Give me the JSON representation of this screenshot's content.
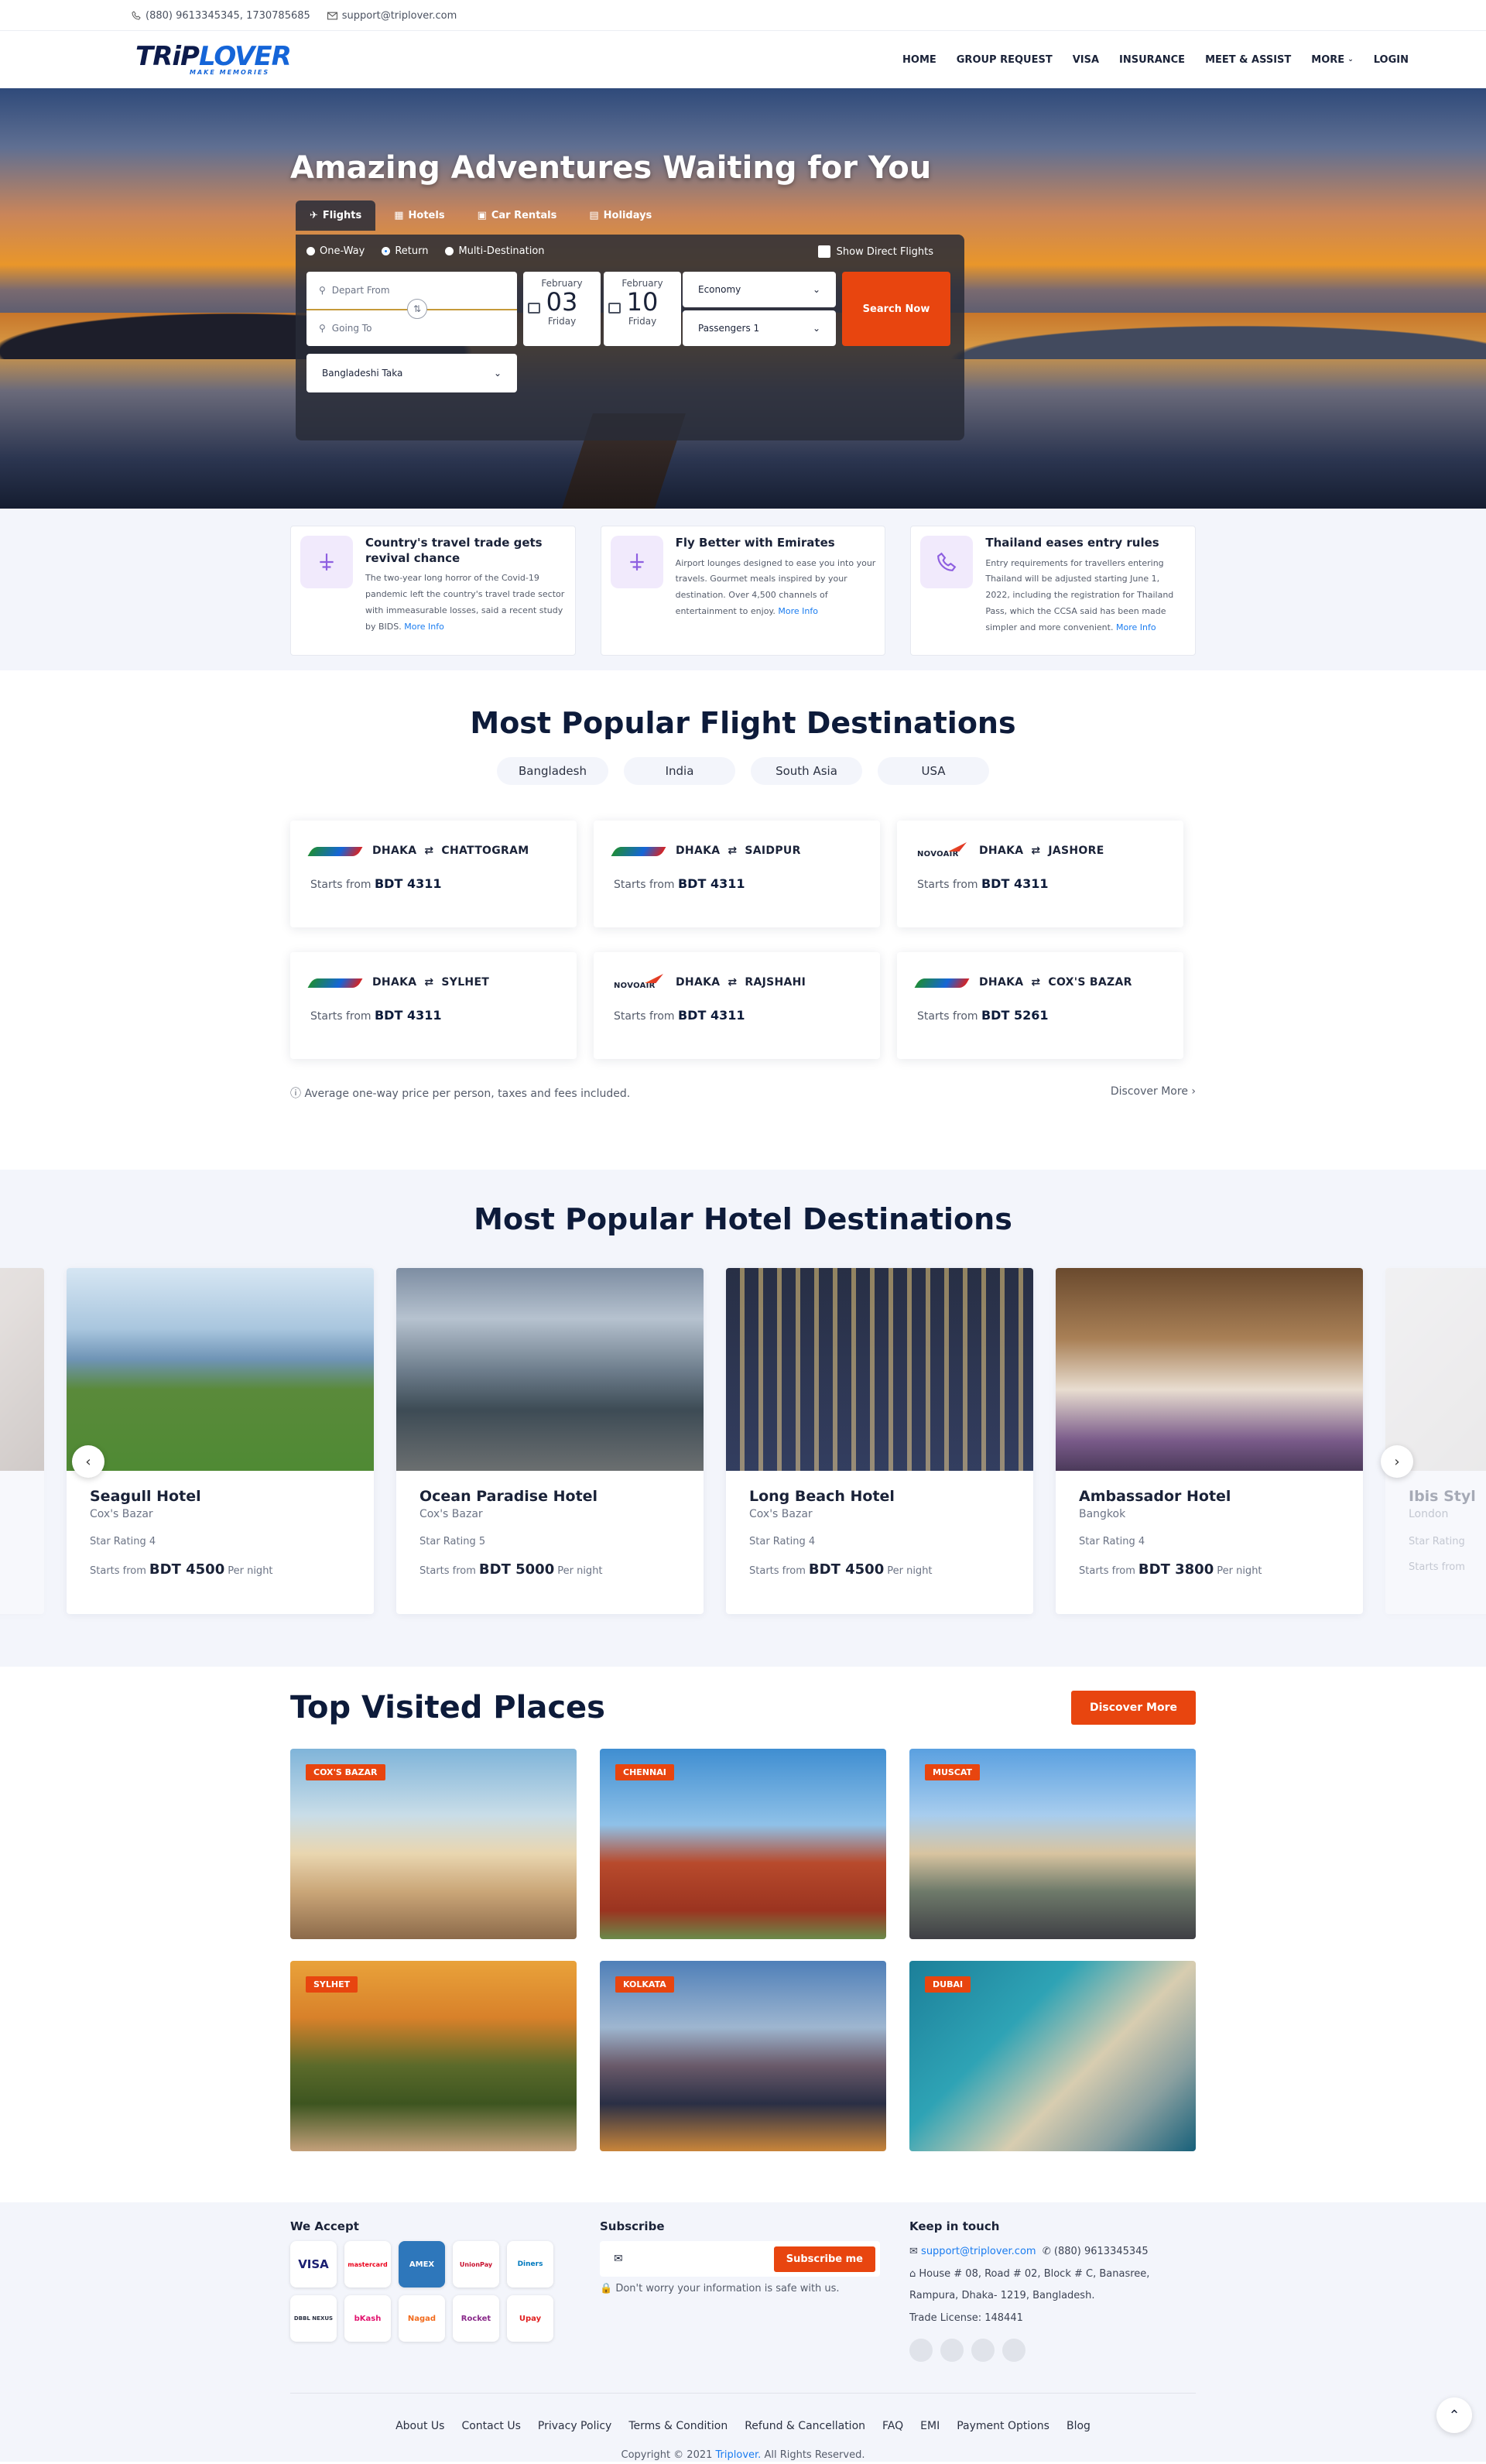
{
  "topbar": {
    "phone": "(880) 9613345345, 1730785685",
    "email": "support@triplover.com"
  },
  "brand": {
    "name_a": "TRiP",
    "name_b": "LOVER",
    "tagline": "MAKE MEMORIES"
  },
  "nav": {
    "home": "HOME",
    "group": "GROUP REQUEST",
    "visa": "VISA",
    "insurance": "INSURANCE",
    "meet": "MEET & ASSIST",
    "more": "MORE",
    "login": "LOGIN"
  },
  "hero": {
    "title": "Amazing Adventures Waiting for You",
    "tabs": [
      "Flights",
      "Hotels",
      "Car Rentals",
      "Holidays"
    ],
    "trip_types": [
      "One-Way",
      "Return",
      "Multi-Destination"
    ],
    "direct": "Show Direct Flights",
    "from_placeholder": "Depart From",
    "to_placeholder": "Going To",
    "depart": {
      "month": "February",
      "day": "03",
      "weekday": "Friday"
    },
    "return": {
      "month": "February",
      "day": "10",
      "weekday": "Friday"
    },
    "cabin": "Economy",
    "passengers": "Passengers 1",
    "search": "Search Now",
    "currency": "Bangladeshi Taka"
  },
  "info": [
    {
      "title": "Country's travel trade gets revival chance",
      "text": "The two-year long horror of the Covid-19 pandemic left the country's travel trade sector with immeasurable losses, said a recent study by BIDS.",
      "more": "More Info"
    },
    {
      "title": "Fly Better with Emirates",
      "text": "Airport lounges designed to ease you into your travels. Gourmet meals inspired by your destination. Over 4,500 channels of entertainment to enjoy.",
      "more": "More Info"
    },
    {
      "title": "Thailand eases entry rules",
      "text": "Entry requirements for travellers entering Thailand will be adjusted starting June 1, 2022, including the registration for Thailand Pass, which the CCSA said has been made simpler and more convenient.",
      "more": "More Info"
    }
  ],
  "flights": {
    "title": "Most Popular Flight Destinations",
    "tabs": [
      "Bangladesh",
      "India",
      "South Asia",
      "USA"
    ],
    "starts": "Starts from",
    "routes": [
      {
        "from": "DHAKA",
        "to": "CHATTOGRAM",
        "price": "BDT 4311",
        "airline": "us"
      },
      {
        "from": "DHAKA",
        "to": "SAIDPUR",
        "price": "BDT 4311",
        "airline": "us"
      },
      {
        "from": "DHAKA",
        "to": "JASHORE",
        "price": "BDT 4311",
        "airline": "nova"
      },
      {
        "from": "DHAKA",
        "to": "SYLHET",
        "price": "BDT 4311",
        "airline": "us"
      },
      {
        "from": "DHAKA",
        "to": "RAJSHAHI",
        "price": "BDT 4311",
        "airline": "nova"
      },
      {
        "from": "DHAKA",
        "to": "COX'S BAZAR",
        "price": "BDT 5261",
        "airline": "us"
      }
    ],
    "note": "Average one-way price per person, taxes and fees included.",
    "discover": "Discover More",
    "nova_label": "NOVOAIR"
  },
  "hotels": {
    "title": "Most Popular Hotel Destinations",
    "starts": "Starts from",
    "per_night": "Per night",
    "items": [
      {
        "name": "",
        "city": "",
        "rating": "",
        "price": ""
      },
      {
        "name": "Seagull Hotel",
        "city": "Cox's Bazar",
        "rating": "Star Rating 4",
        "price": "BDT 4500"
      },
      {
        "name": "Ocean Paradise Hotel",
        "city": "Cox's Bazar",
        "rating": "Star Rating 5",
        "price": "BDT 5000"
      },
      {
        "name": "Long Beach Hotel",
        "city": "Cox's Bazar",
        "rating": "Star Rating 4",
        "price": "BDT 4500"
      },
      {
        "name": "Ambassador Hotel",
        "city": "Bangkok",
        "rating": "Star Rating 4",
        "price": "BDT 3800"
      },
      {
        "name": "Ibis Styl",
        "city": "London",
        "rating": "Star Rating",
        "price": ""
      }
    ]
  },
  "places": {
    "title": "Top Visited Places",
    "discover": "Discover More",
    "items": [
      "COX'S BAZAR",
      "CHENNAI",
      "MUSCAT",
      "SYLHET",
      "KOLKATA",
      "DUBAI"
    ]
  },
  "footer": {
    "accept": "We Accept",
    "cards": [
      "VISA",
      "mastercard",
      "AMEX",
      "UnionPay",
      "Diners",
      "DBBL NEXUS",
      "bKash",
      "Nagad",
      "Rocket",
      "Upay"
    ],
    "subscribe": "Subscribe",
    "sub_btn": "Subscribe me",
    "sub_note": "Don't worry your information is safe with us.",
    "touch": "Keep in touch",
    "email": "support@triplover.com",
    "phone": "(880) 9613345345",
    "address1": "House # 08, Road # 02, Block # C, Banasree,",
    "address2": "Rampura, Dhaka- 1219, Bangladesh.",
    "license": "Trade License: 148441",
    "links": [
      "About Us",
      "Contact Us",
      "Privacy Policy",
      "Terms & Condition",
      "Refund & Cancellation",
      "FAQ",
      "EMI",
      "Payment Options",
      "Blog"
    ],
    "copy_a": "Copyright © 2021",
    "copy_b": "Triplover.",
    "copy_c": "All Rights Reserved."
  }
}
